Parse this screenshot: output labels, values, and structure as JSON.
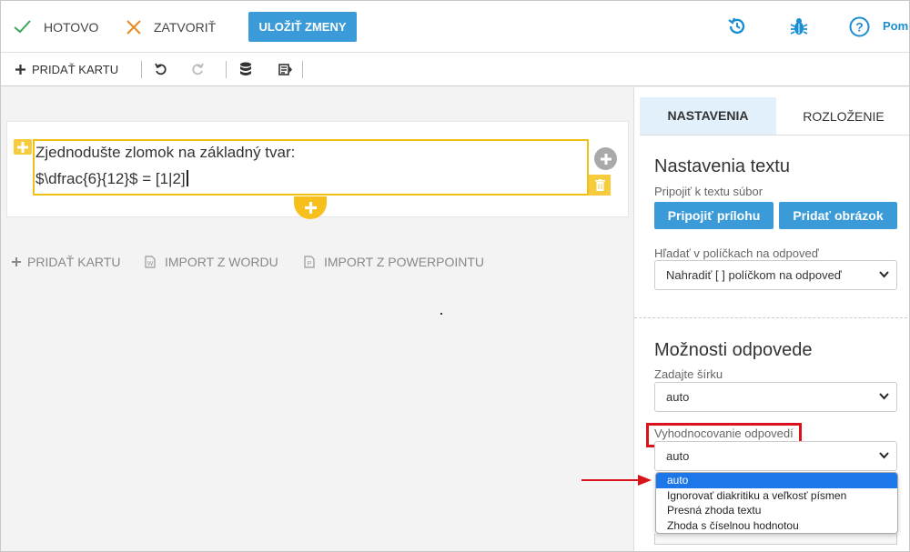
{
  "topbar": {
    "done_label": "HOTOVO",
    "close_label": "ZATVORIŤ",
    "save_label": "ULOŽIŤ ZMENY",
    "help_label": "Pom",
    "accent": "#3b9bd9"
  },
  "toolbar": {
    "add_card_label": "PRIDAŤ KARTU"
  },
  "editor": {
    "line1": "Zjednodušte zlomok na základný tvar:",
    "line2": "$\\dfrac{6}{12}$ = [1|2]"
  },
  "canvas_actions": {
    "add_card": "PRIDAŤ KARTU",
    "import_word": "IMPORT Z WORDU",
    "import_ppt": "IMPORT Z POWERPOINTU"
  },
  "panel": {
    "tabs": [
      {
        "label": "NASTAVENIA",
        "active": true
      },
      {
        "label": "ROZLOŽENIE",
        "active": false
      }
    ],
    "text_settings": {
      "title": "Nastavenia textu",
      "attach_label": "Pripojiť k textu súbor",
      "attach_button": "Pripojiť prílohu",
      "image_button": "Pridať obrázok",
      "search_label": "Hľadať v políčkach na odpoveď",
      "search_value": "Nahradiť [ ] políčkom na odpoveď"
    },
    "answer_options": {
      "title": "Možnosti odpovede",
      "width_label": "Zadajte šírku",
      "width_value": "auto",
      "eval_label": "Vyhodnocovanie odpovedí",
      "eval_value": "auto",
      "eval_options": [
        "auto",
        "Ignorovať diakritiku a veľkosť písmen",
        "Presná zhoda textu",
        "Zhoda s číselnou hodnotou"
      ]
    }
  },
  "colors": {
    "highlight": "#d9121b",
    "editor_border": "#f0c018",
    "selected_option": "#1e77e8"
  }
}
